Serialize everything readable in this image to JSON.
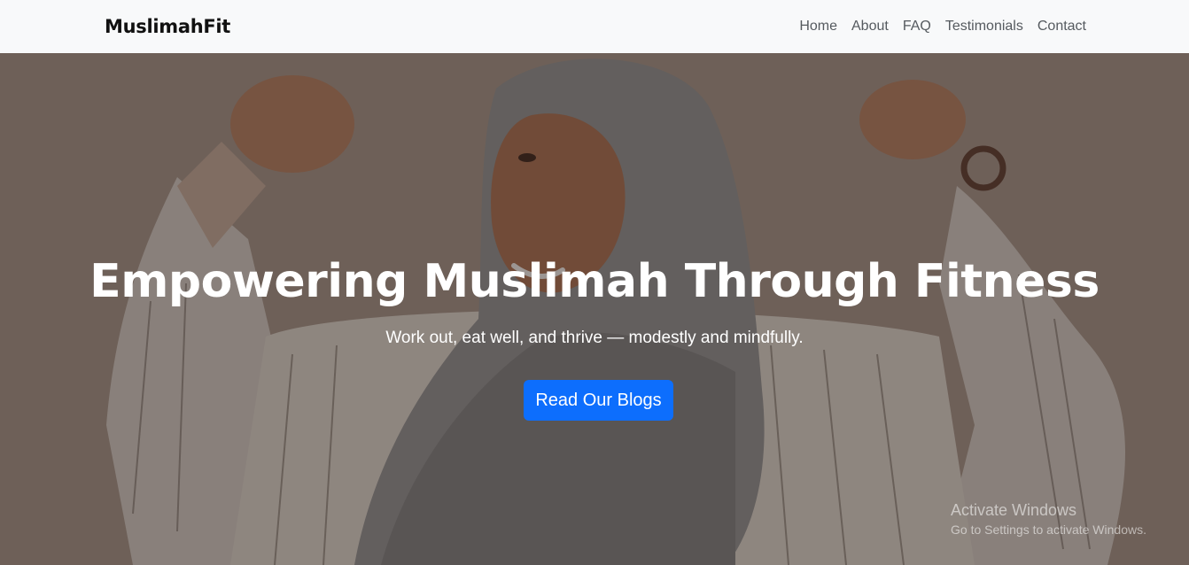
{
  "nav": {
    "brand": "MuslimahFit",
    "links": [
      "Home",
      "About",
      "FAQ",
      "Testimonials",
      "Contact"
    ]
  },
  "hero": {
    "title": "Empowering Muslimah Through Fitness",
    "subtitle": "Work out, eat well, and thrive — modestly and mindfully.",
    "button_label": "Read Our Blogs"
  },
  "watermark": {
    "title": "Activate Windows",
    "subtitle": "Go to Settings to activate Windows."
  },
  "colors": {
    "navbar_bg": "#f8f9fa",
    "button_bg": "#0d6efd",
    "hero_overlay": "#281e1c"
  }
}
